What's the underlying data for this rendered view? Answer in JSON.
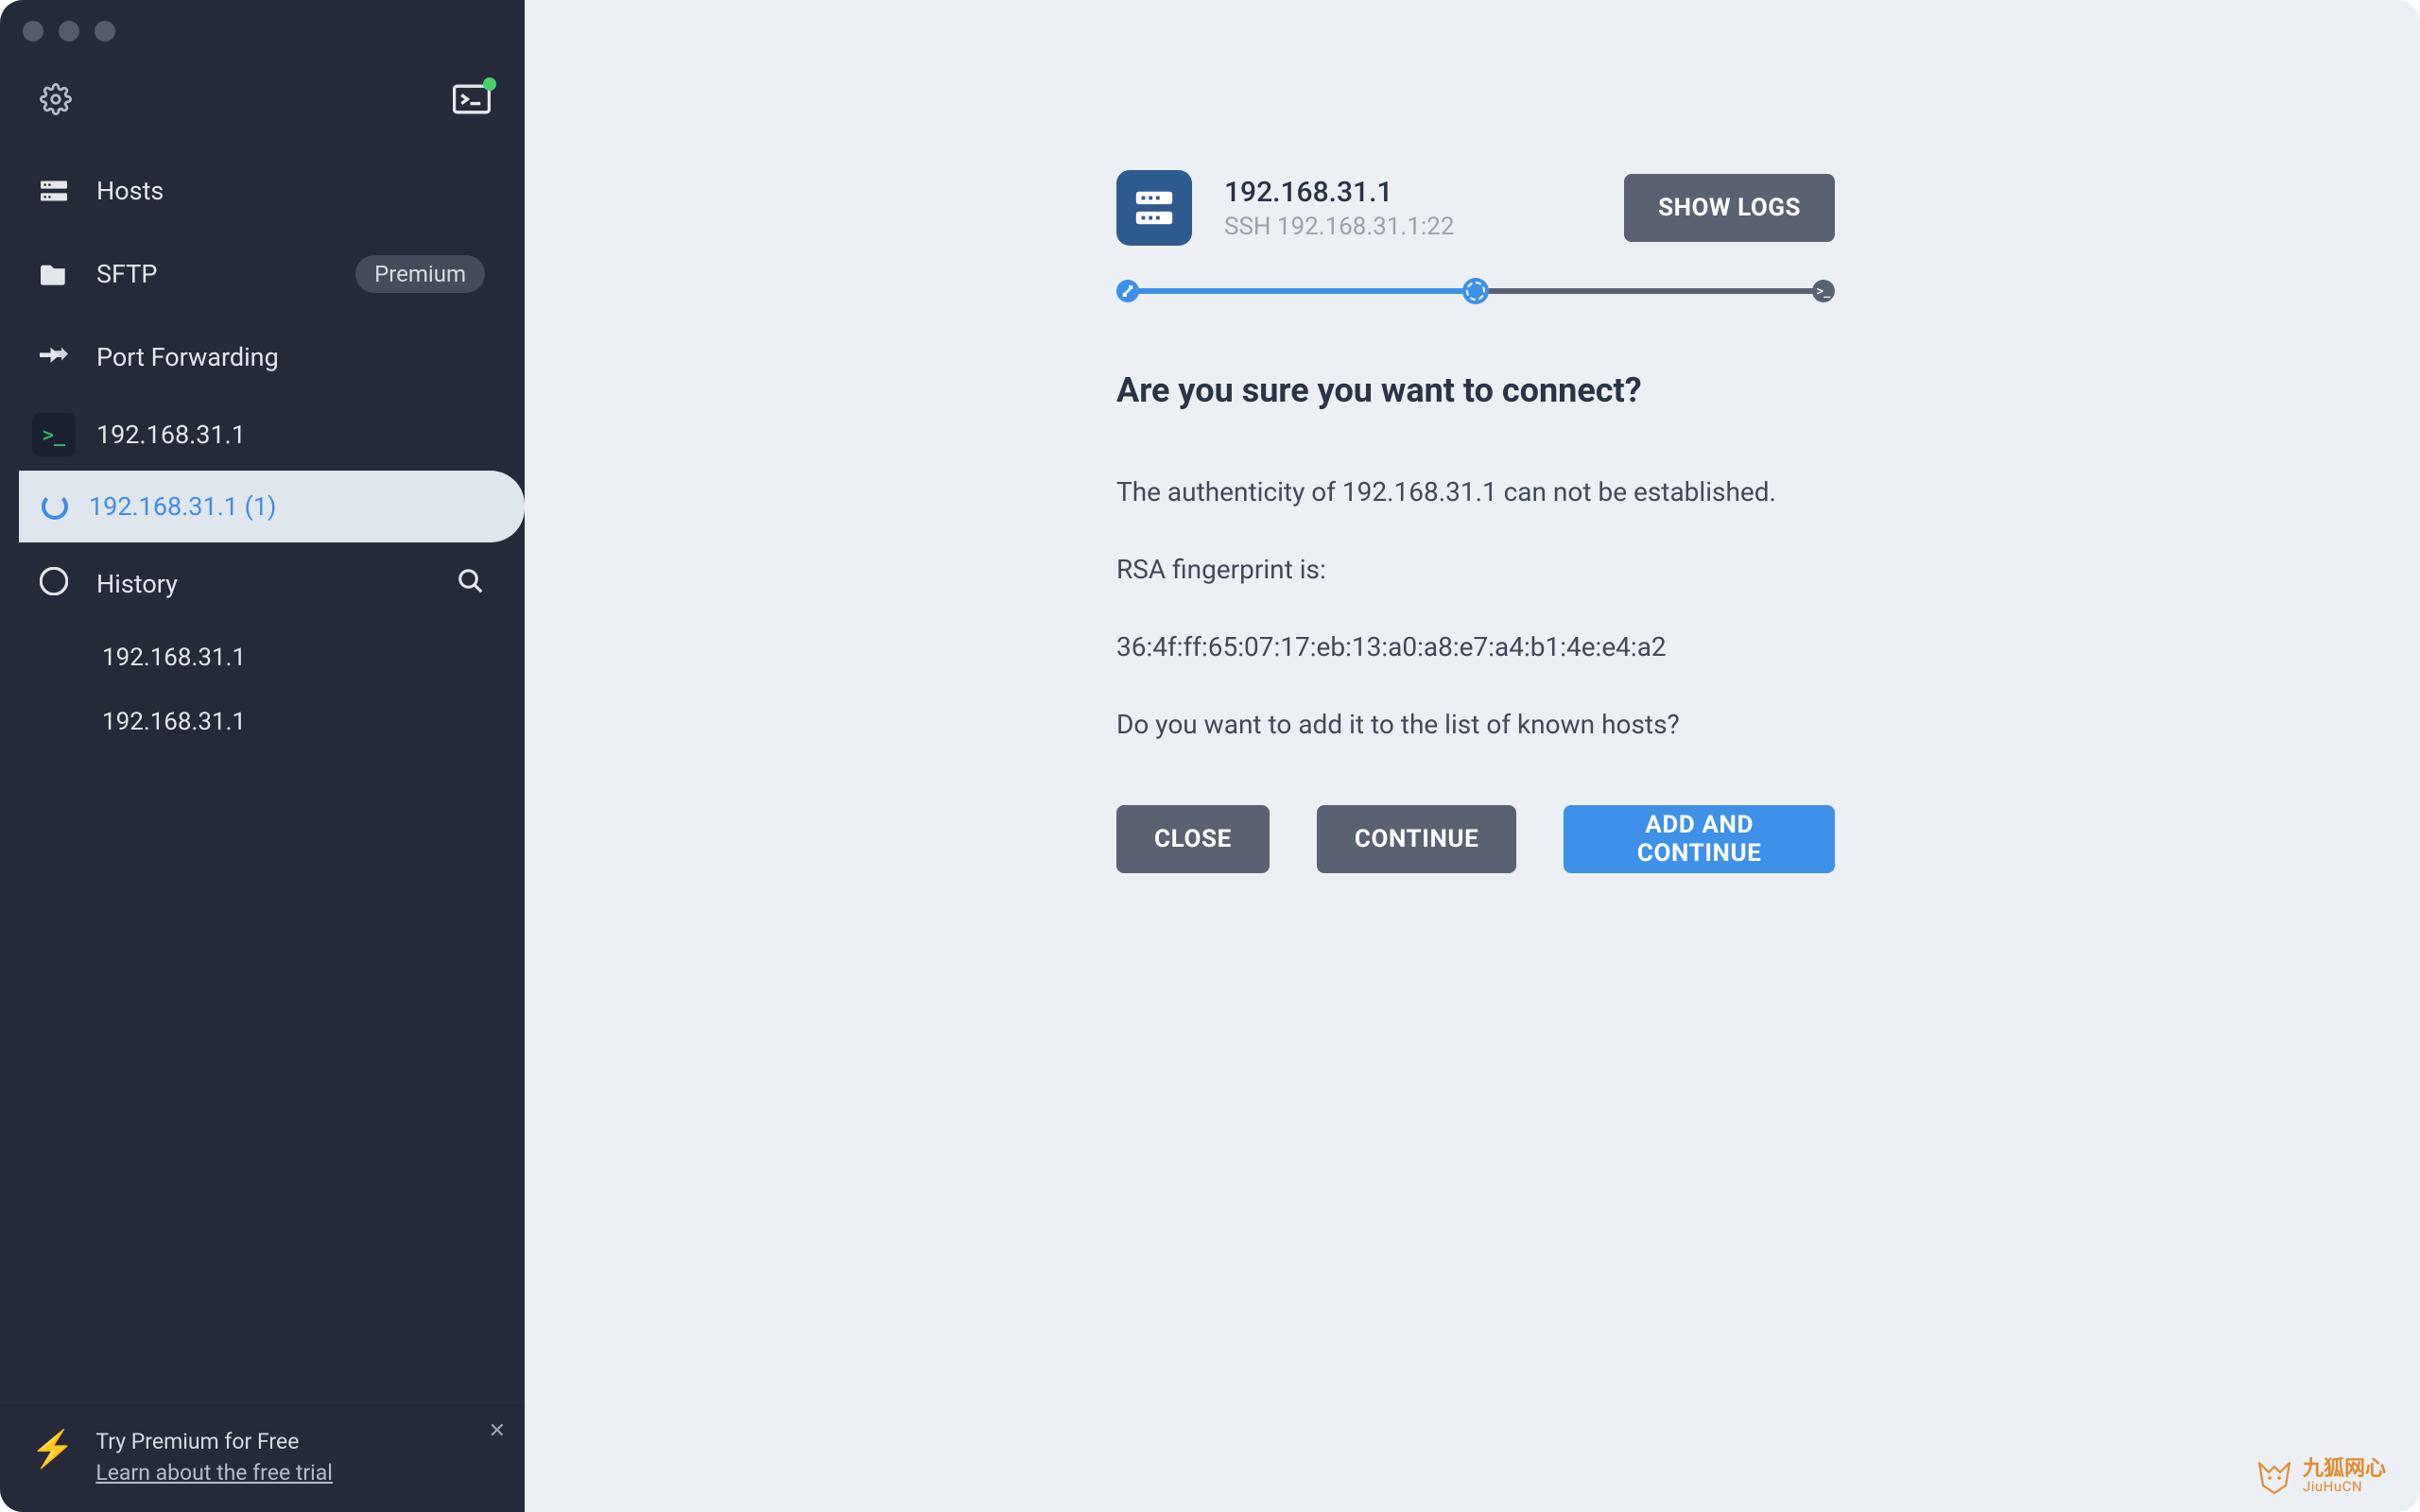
{
  "sidebar": {
    "nav": {
      "hosts": "Hosts",
      "sftp": "SFTP",
      "sftp_badge": "Premium",
      "port_forwarding": "Port Forwarding"
    },
    "sessions": [
      {
        "label": "192.168.31.1"
      },
      {
        "label": "192.168.31.1 (1)"
      }
    ],
    "history": {
      "title": "History",
      "items": [
        "192.168.31.1",
        "192.168.31.1"
      ]
    },
    "promo": {
      "title": "Try Premium for Free",
      "link": "Learn about the free trial"
    }
  },
  "connection": {
    "host_ip": "192.168.31.1",
    "host_sub": "SSH 192.168.31.1:22",
    "show_logs": "SHOW LOGS",
    "prompt_title": "Are you sure you want to connect?",
    "auth_line": "The authenticity of 192.168.31.1 can not be established.",
    "fp_label": "RSA fingerprint is:",
    "fingerprint": "36:4f:ff:65:07:17:eb:13:a0:a8:e7:a4:b1:4e:e4:a2",
    "known_hosts_q": "Do you want to add it to the list of known hosts?",
    "buttons": {
      "close": "CLOSE",
      "continue": "CONTINUE",
      "add_continue": "ADD AND CONTINUE"
    }
  },
  "watermark": {
    "cn": "九狐网心",
    "en": "JiuHuCN"
  }
}
